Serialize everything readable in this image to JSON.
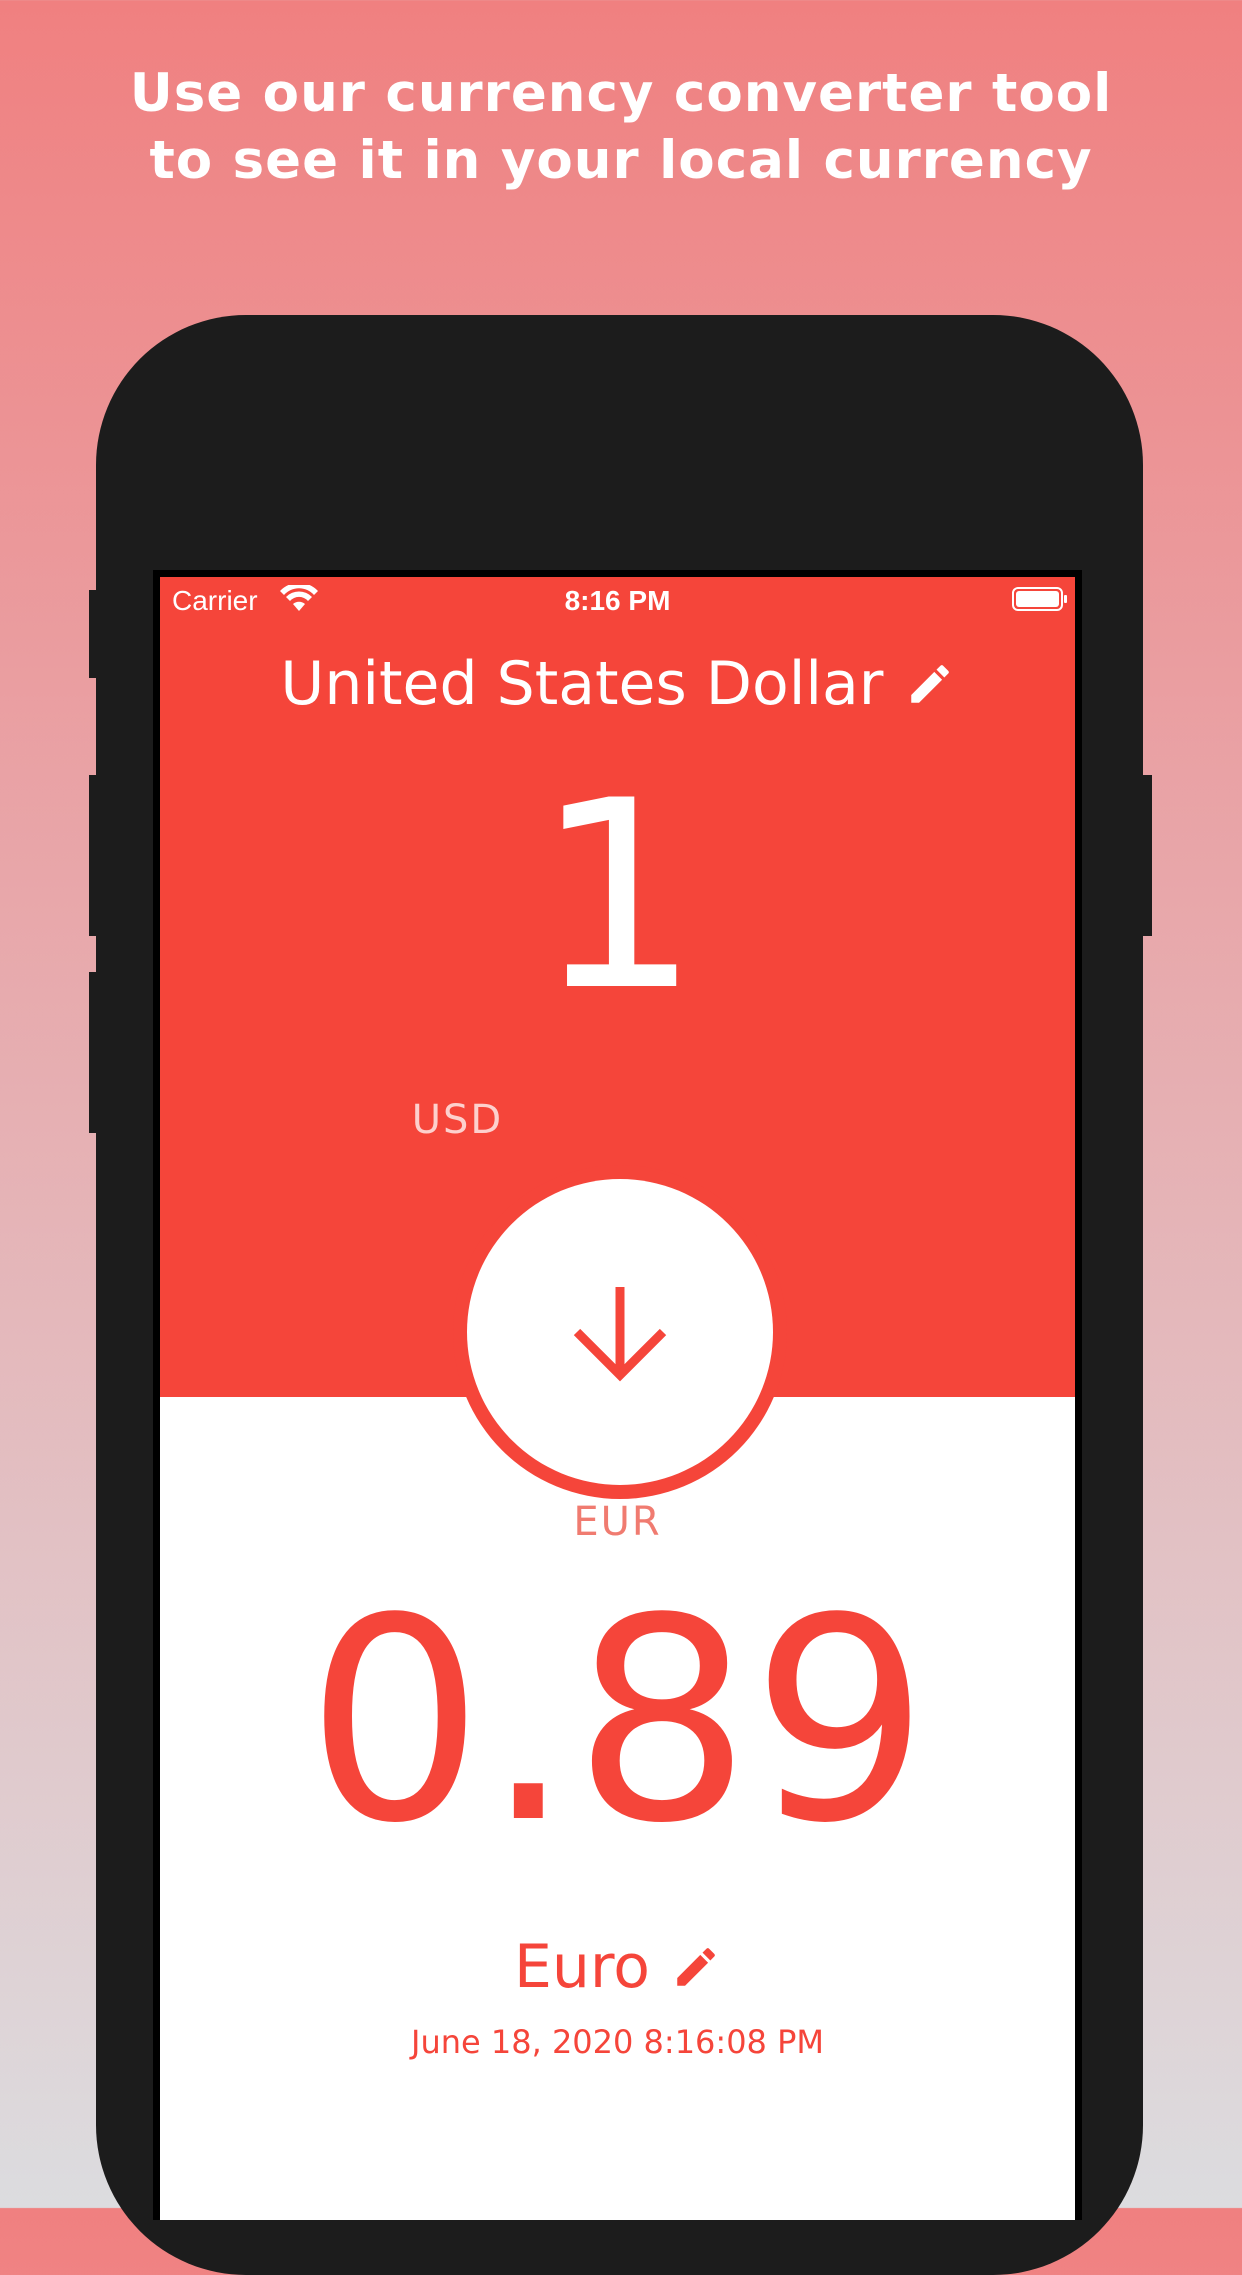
{
  "headline": {
    "line1": "Use our currency converter tool",
    "line2": "to see it in your local currency"
  },
  "status_bar": {
    "carrier": "Carrier",
    "time": "8:16 PM",
    "icons": [
      "wifi-icon",
      "battery-icon"
    ]
  },
  "source": {
    "name": "United States Dollar",
    "amount": "1",
    "code": "USD",
    "edit_icon": "pencil-icon"
  },
  "swap_button": {
    "icon": "arrow-down-icon"
  },
  "target": {
    "code": "EUR",
    "amount": "0.89",
    "name": "Euro",
    "edit_icon": "pencil-icon",
    "timestamp": "June 18, 2020 8:16:08 PM"
  },
  "colors": {
    "accent": "#f5453a",
    "background_top": "#f08080",
    "background_bottom": "#dcdcdf",
    "device": "#1c1c1c"
  }
}
